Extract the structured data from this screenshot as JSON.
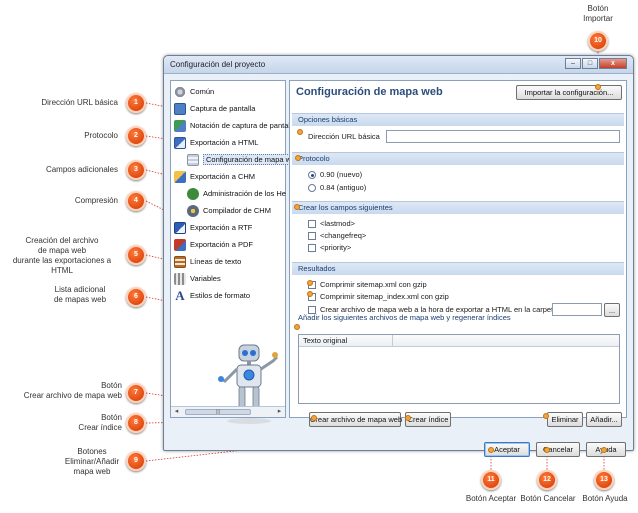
{
  "window": {
    "title": "Configuración del proyecto",
    "controls": {
      "minimize": "–",
      "maximize": "□",
      "close": "x"
    }
  },
  "tree": {
    "items": [
      {
        "label": "Común",
        "icon": "gear-icon",
        "color": "#8a8f99"
      },
      {
        "label": "Captura de pantalla",
        "icon": "screenshot-icon",
        "color": "#4f7fc4"
      },
      {
        "label": "Notación de captura de pantal",
        "icon": "annotation-icon",
        "color": "#3f9a52"
      },
      {
        "label": "Exportación a HTML",
        "icon": "html-export-icon",
        "color": "#3d6fc0"
      },
      {
        "label": "Configuración de mapa w",
        "icon": "sitemap-icon",
        "color": "#aab4c2"
      },
      {
        "label": "Exportación a CHM",
        "icon": "chm-export-icon",
        "color": "#c58b2a"
      },
      {
        "label": "Administración de los He",
        "icon": "help-id-icon",
        "color": "#3c8a3c"
      },
      {
        "label": "Compilador de CHM",
        "icon": "compiler-icon",
        "color": "#5a6a7c"
      },
      {
        "label": "Exportación a RTF",
        "icon": "rtf-export-icon",
        "color": "#2d5db5"
      },
      {
        "label": "Exportación a PDF",
        "icon": "pdf-export-icon",
        "color": "#c43a2a"
      },
      {
        "label": "Líneas de texto",
        "icon": "text-lines-icon",
        "color": "#b56c2a"
      },
      {
        "label": "Variables",
        "icon": "variables-icon",
        "color": "#8c8c8c"
      },
      {
        "label": "Estilos de formato",
        "icon": "font-style-icon",
        "color": "#2e4a8c"
      }
    ],
    "scroll_thumb": "|||"
  },
  "content": {
    "title": "Configuración de mapa web",
    "import_button": "Importar la configuración...",
    "sections": {
      "basic": "Opciones básicas",
      "protocol": "Protocolo",
      "fields": "Crear los campos siguientes",
      "results": "Resultados",
      "add_files": "Añadir los siguientes archivos de mapa web y regenerar índices"
    },
    "url_label": "Dirección URL básica",
    "url_value": "",
    "protocol_options": [
      {
        "label": "0.90 (nuevo)",
        "selected": true
      },
      {
        "label": "0.84 (antiguo)",
        "selected": false
      }
    ],
    "field_options": [
      {
        "label": "<lastmod>",
        "checked": false
      },
      {
        "label": "<changefreq>",
        "checked": false
      },
      {
        "label": "<priority>",
        "checked": false
      }
    ],
    "result_options": [
      {
        "label": "Comprimir sitemap.xml con gzip",
        "checked": false
      },
      {
        "label": "Comprimir sitemap_index.xml con gzip",
        "checked": false
      },
      {
        "label": "Crear archivo de mapa web a la hora de exportar a HTML en la carpeta",
        "checked": false
      }
    ],
    "folder_value": "",
    "browse_button": "...",
    "grid": {
      "column_header": "Texto original"
    },
    "create_sitemap_button": "Crear archivo de mapa web",
    "create_index_button": "Crear índice",
    "delete_button": "Eliminar",
    "add_button": "Añadir..."
  },
  "footer": {
    "ok": "Aceptar",
    "cancel": "Cancelar",
    "help": "Ayuda"
  },
  "callouts": [
    {
      "num": "1",
      "label": "Dirección URL básica"
    },
    {
      "num": "2",
      "label": "Protocolo"
    },
    {
      "num": "3",
      "label": "Campos adicionales"
    },
    {
      "num": "4",
      "label": "Compresión"
    },
    {
      "num": "5",
      "label": "Creación del archivo\nde mapa web\ndurante las exportaciones a HTML"
    },
    {
      "num": "6",
      "label": "Lista adicional\nde mapas web"
    },
    {
      "num": "7",
      "label": "Botón\nCrear archivo de mapa web"
    },
    {
      "num": "8",
      "label": "Botón\nCrear índice"
    },
    {
      "num": "9",
      "label": "Botones\nEliminar/Añadir\nmapa web"
    },
    {
      "num": "10",
      "label": "Botón\nImportar"
    },
    {
      "num": "11",
      "label": "Botón Aceptar"
    },
    {
      "num": "12",
      "label": "Botón Cancelar"
    },
    {
      "num": "13",
      "label": "Botón Ayuda"
    }
  ],
  "colors": {
    "badge": "#e04b12",
    "leader_line": "#d9312a",
    "section_text": "#1c3e6e",
    "title_text": "#2b4d7a"
  }
}
